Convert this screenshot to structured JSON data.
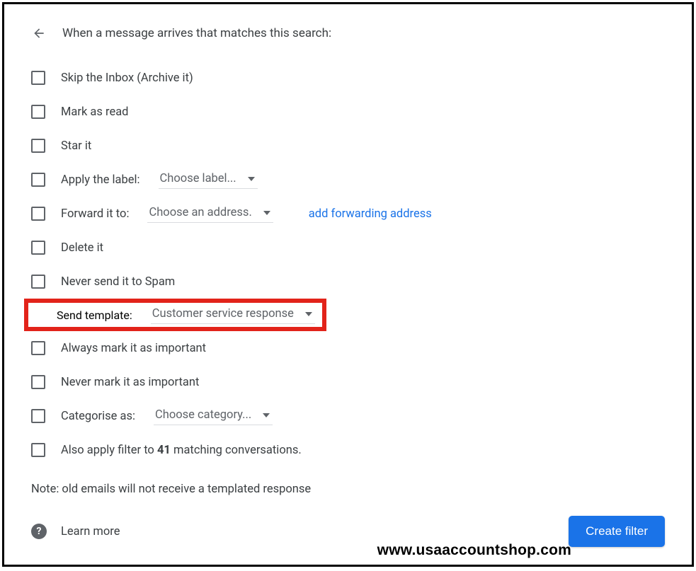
{
  "header": {
    "title": "When a message arrives that matches this search:"
  },
  "options": {
    "skip_inbox": {
      "label": "Skip the Inbox (Archive it)",
      "checked": false
    },
    "mark_read": {
      "label": "Mark as read",
      "checked": false
    },
    "star_it": {
      "label": "Star it",
      "checked": false
    },
    "apply_label": {
      "label": "Apply the label:",
      "checked": false,
      "dropdown": "Choose label..."
    },
    "forward_to": {
      "label": "Forward it to:",
      "checked": false,
      "dropdown": "Choose an address.",
      "link": "add forwarding address"
    },
    "delete_it": {
      "label": "Delete it",
      "checked": false
    },
    "never_spam": {
      "label": "Never send it to Spam",
      "checked": false
    },
    "send_template": {
      "label": "Send template:",
      "checked": true,
      "dropdown": "Customer service response"
    },
    "always_important": {
      "label": "Always mark it as important",
      "checked": false
    },
    "never_important": {
      "label": "Never mark it as important",
      "checked": false
    },
    "categorise_as": {
      "label": "Categorise as:",
      "checked": false,
      "dropdown": "Choose category..."
    },
    "also_apply": {
      "prefix": "Also apply filter to ",
      "count": "41",
      "suffix": " matching conversations.",
      "checked": false
    }
  },
  "note": "Note: old emails will not receive a templated response",
  "footer": {
    "learn_more": "Learn more",
    "create_button": "Create filter"
  },
  "watermark": "www.usaaccountshop.com"
}
